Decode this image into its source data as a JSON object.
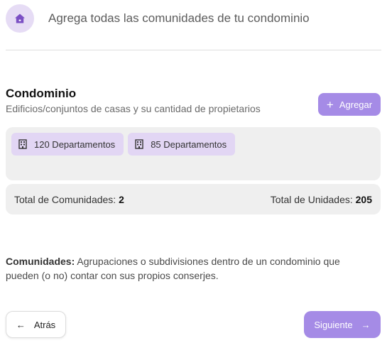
{
  "header": {
    "title": "Agrega todas las comunidades de tu condominio",
    "icon": "home-icon",
    "accent_color": "#e6dcf5"
  },
  "section": {
    "title": "Condominio",
    "subtitle": "Edificios/conjuntos de casas y su cantidad de propietarios"
  },
  "add_button": {
    "label": "Agregar",
    "icon": "plus-icon",
    "color": "#a58be6"
  },
  "communities": [
    {
      "label": "120 Departamentos",
      "icon": "building-icon"
    },
    {
      "label": "85 Departamentos",
      "icon": "building-icon"
    }
  ],
  "totals": {
    "communities_label": "Total de Comunidades:",
    "communities_value": "2",
    "units_label": "Total de Unidades:",
    "units_value": "205"
  },
  "info": {
    "term": "Comunidades:",
    "text": "Agrupaciones o subdivisiones dentro de un condominio que pueden (o no) contar con sus propios conserjes."
  },
  "nav": {
    "back_label": "Atrás",
    "back_icon": "arrow-left-icon",
    "next_label": "Siguiente",
    "next_icon": "arrow-right-icon"
  }
}
